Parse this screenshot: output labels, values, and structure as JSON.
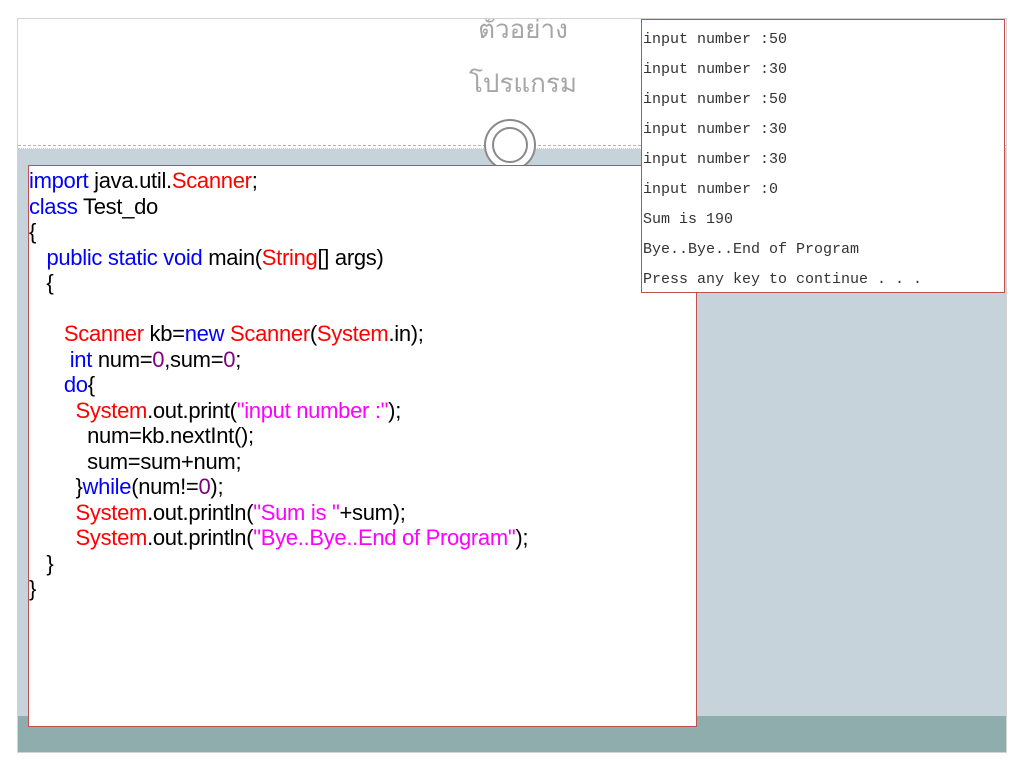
{
  "slide": {
    "title_line1": "ตัวอย่าง",
    "title_line2": "โปรแกรม"
  },
  "code": {
    "lines": [
      [
        {
          "t": "import",
          "c": "kw"
        },
        {
          "t": " java.util.",
          "c": ""
        },
        {
          "t": "Scanner",
          "c": "cls"
        },
        {
          "t": ";",
          "c": ""
        }
      ],
      [
        {
          "t": "class",
          "c": "kw"
        },
        {
          "t": " Test_do",
          "c": ""
        }
      ],
      [
        {
          "t": "{",
          "c": ""
        }
      ],
      [
        {
          "t": "   ",
          "c": ""
        },
        {
          "t": "public static void",
          "c": "kw"
        },
        {
          "t": " main(",
          "c": ""
        },
        {
          "t": "String",
          "c": "cls"
        },
        {
          "t": "[] args)",
          "c": ""
        }
      ],
      [
        {
          "t": "   {",
          "c": ""
        }
      ],
      [
        {
          "t": "",
          "c": ""
        }
      ],
      [
        {
          "t": "      ",
          "c": ""
        },
        {
          "t": "Scanner",
          "c": "cls"
        },
        {
          "t": " kb=",
          "c": ""
        },
        {
          "t": "new",
          "c": "kw"
        },
        {
          "t": " ",
          "c": ""
        },
        {
          "t": "Scanner",
          "c": "cls"
        },
        {
          "t": "(",
          "c": ""
        },
        {
          "t": "System",
          "c": "cls"
        },
        {
          "t": ".in);",
          "c": ""
        }
      ],
      [
        {
          "t": "       ",
          "c": ""
        },
        {
          "t": "int",
          "c": "kw"
        },
        {
          "t": " num=",
          "c": ""
        },
        {
          "t": "0",
          "c": "num"
        },
        {
          "t": ",sum=",
          "c": ""
        },
        {
          "t": "0",
          "c": "num"
        },
        {
          "t": ";",
          "c": ""
        }
      ],
      [
        {
          "t": "      ",
          "c": ""
        },
        {
          "t": "do",
          "c": "kw"
        },
        {
          "t": "{",
          "c": ""
        }
      ],
      [
        {
          "t": "        ",
          "c": ""
        },
        {
          "t": "System",
          "c": "cls"
        },
        {
          "t": ".out.print(",
          "c": ""
        },
        {
          "t": "\"input number :\"",
          "c": "str"
        },
        {
          "t": ");",
          "c": ""
        }
      ],
      [
        {
          "t": "          num=kb.nextInt();",
          "c": ""
        }
      ],
      [
        {
          "t": "          sum=sum+num;",
          "c": ""
        }
      ],
      [
        {
          "t": "        }",
          "c": ""
        },
        {
          "t": "while",
          "c": "kw"
        },
        {
          "t": "(num!=",
          "c": ""
        },
        {
          "t": "0",
          "c": "num"
        },
        {
          "t": ");",
          "c": ""
        }
      ],
      [
        {
          "t": "        ",
          "c": ""
        },
        {
          "t": "System",
          "c": "cls"
        },
        {
          "t": ".out.println(",
          "c": ""
        },
        {
          "t": "\"Sum is \"",
          "c": "str"
        },
        {
          "t": "+sum);",
          "c": ""
        }
      ],
      [
        {
          "t": "        ",
          "c": ""
        },
        {
          "t": "System",
          "c": "cls"
        },
        {
          "t": ".out.println(",
          "c": ""
        },
        {
          "t": "\"Bye..Bye..End of Program\"",
          "c": "str"
        },
        {
          "t": ");",
          "c": ""
        }
      ],
      [
        {
          "t": "   }",
          "c": ""
        }
      ],
      [
        {
          "t": "}",
          "c": ""
        }
      ]
    ]
  },
  "console": {
    "lines": [
      "input number :50",
      "input number :30",
      "input number :50",
      "input number :30",
      "input number :30",
      "input number :0",
      "Sum is 190",
      "Bye..Bye..End of Program",
      "Press any key to continue . . ."
    ]
  },
  "colors": {
    "keyword": "#0000ff",
    "class_name": "#ff0000",
    "string": "#ff00ff",
    "number": "#800080",
    "content_background": "#c6d3da",
    "footer_band": "#8fadad",
    "box_border": "#c0504d"
  }
}
